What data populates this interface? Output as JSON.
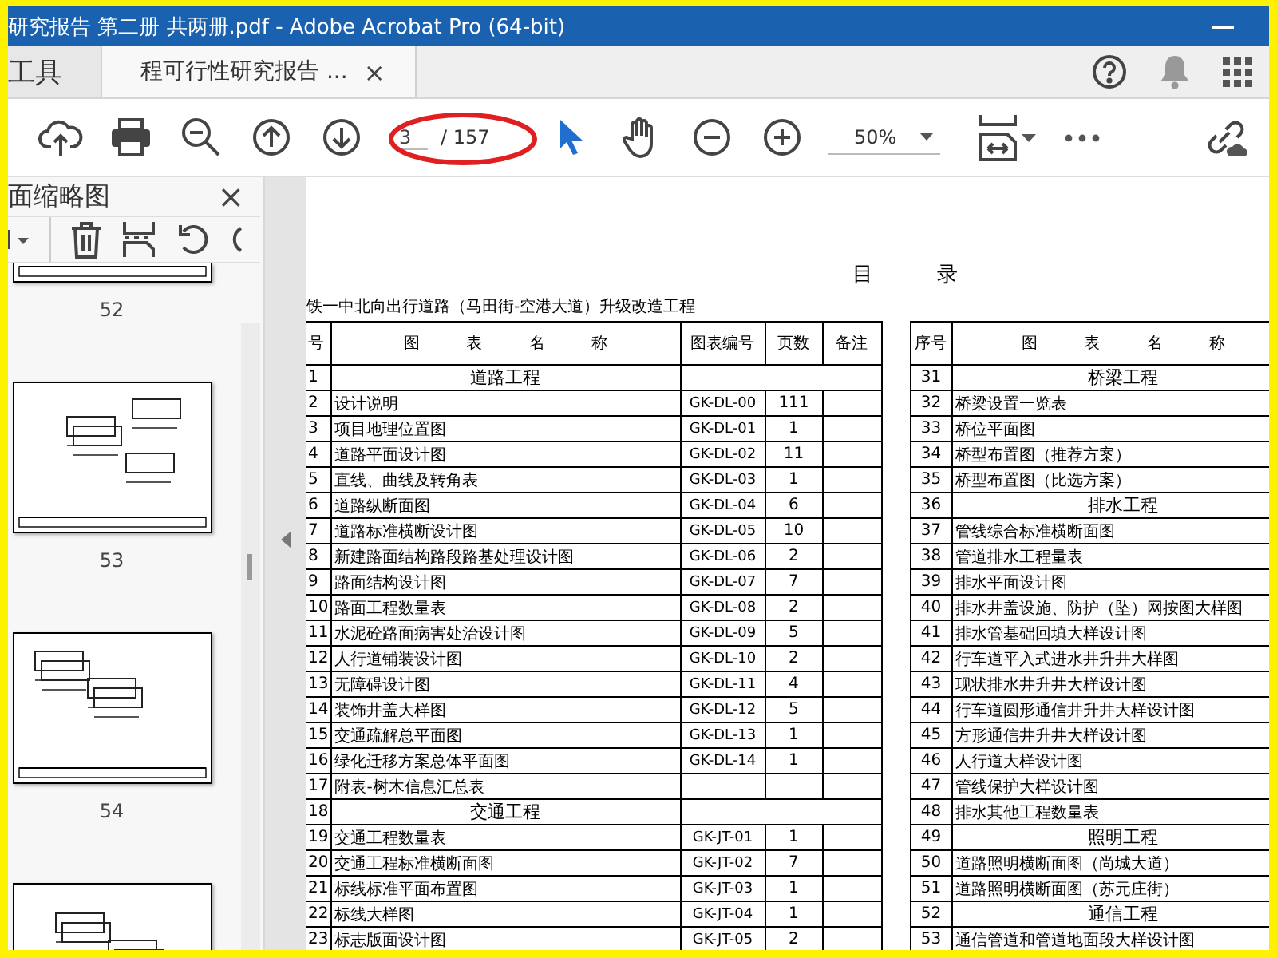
{
  "window": {
    "title": "研究报告 第二册 共两册.pdf - Adobe Acrobat Pro (64-bit)"
  },
  "tabs": [
    {
      "label": "工具",
      "kind": "home",
      "selected": false
    },
    {
      "label": "程可行性研究报告 ...",
      "kind": "document",
      "selected": true,
      "close": "×"
    }
  ],
  "toolbar": {
    "page_field": "3",
    "page_total": "/ 157",
    "zoom": "50%"
  },
  "sidebar": {
    "title": "面缩略图",
    "close": "×",
    "thumbnails": [
      {
        "label": "52",
        "kind": "cut_top"
      },
      {
        "label": "53",
        "kind": "full"
      },
      {
        "label": "54",
        "kind": "full"
      },
      {
        "kind": "cut_bottom"
      }
    ]
  },
  "document": {
    "heading": "目 录",
    "subtitle": "铁一中北向出行道路（马田街-空港大道）升级改造工程",
    "left_table": {
      "columns": [
        "号",
        "图 表 名 称",
        "图表编号",
        "页数",
        "备注"
      ],
      "rows": [
        {
          "kind": "section",
          "no": "1",
          "name": "道路工程"
        },
        {
          "kind": "item",
          "no": "2",
          "name": "设计说明",
          "code": "GK-DL-00",
          "pages": "111"
        },
        {
          "kind": "item",
          "no": "3",
          "name": "项目地理位置图",
          "code": "GK-DL-01",
          "pages": "1"
        },
        {
          "kind": "item",
          "no": "4",
          "name": "道路平面设计图",
          "code": "GK-DL-02",
          "pages": "11"
        },
        {
          "kind": "item",
          "no": "5",
          "name": "直线、曲线及转角表",
          "code": "GK-DL-03",
          "pages": "1"
        },
        {
          "kind": "item",
          "no": "6",
          "name": "道路纵断面图",
          "code": "GK-DL-04",
          "pages": "6"
        },
        {
          "kind": "item",
          "no": "7",
          "name": "道路标准横断设计图",
          "code": "GK-DL-05",
          "pages": "10"
        },
        {
          "kind": "item",
          "no": "8",
          "name": "新建路面结构路段路基处理设计图",
          "code": "GK-DL-06",
          "pages": "2"
        },
        {
          "kind": "item",
          "no": "9",
          "name": "路面结构设计图",
          "code": "GK-DL-07",
          "pages": "7"
        },
        {
          "kind": "item",
          "no": "10",
          "name": "路面工程数量表",
          "code": "GK-DL-08",
          "pages": "2"
        },
        {
          "kind": "item",
          "no": "11",
          "name": "水泥砼路面病害处治设计图",
          "code": "GK-DL-09",
          "pages": "5"
        },
        {
          "kind": "item",
          "no": "12",
          "name": "人行道铺装设计图",
          "code": "GK-DL-10",
          "pages": "2"
        },
        {
          "kind": "item",
          "no": "13",
          "name": "无障碍设计图",
          "code": "GK-DL-11",
          "pages": "4"
        },
        {
          "kind": "item",
          "no": "14",
          "name": "装饰井盖大样图",
          "code": "GK-DL-12",
          "pages": "5"
        },
        {
          "kind": "item",
          "no": "15",
          "name": "交通疏解总平面图",
          "code": "GK-DL-13",
          "pages": "1"
        },
        {
          "kind": "item",
          "no": "16",
          "name": "绿化迁移方案总体平面图",
          "code": "GK-DL-14",
          "pages": "1"
        },
        {
          "kind": "item",
          "no": "17",
          "name": "附表-树木信息汇总表"
        },
        {
          "kind": "section",
          "no": "18",
          "name": "交通工程"
        },
        {
          "kind": "item",
          "no": "19",
          "name": "交通工程数量表",
          "code": "GK-JT-01",
          "pages": "1"
        },
        {
          "kind": "item",
          "no": "20",
          "name": "交通工程标准横断面图",
          "code": "GK-JT-02",
          "pages": "7"
        },
        {
          "kind": "item",
          "no": "21",
          "name": "标线标准平面布置图",
          "code": "GK-JT-03",
          "pages": "1"
        },
        {
          "kind": "item",
          "no": "22",
          "name": "标线大样图",
          "code": "GK-JT-04",
          "pages": "1"
        },
        {
          "kind": "item",
          "no": "23",
          "name": "标志版面设计图",
          "code": "GK-JT-05",
          "pages": "2"
        }
      ]
    },
    "right_table": {
      "columns": [
        "序号",
        "图 表 名 称"
      ],
      "rows": [
        {
          "kind": "section",
          "no": "31",
          "name": "桥梁工程"
        },
        {
          "kind": "item",
          "no": "32",
          "name": "桥梁设置一览表"
        },
        {
          "kind": "item",
          "no": "33",
          "name": "桥位平面图"
        },
        {
          "kind": "item",
          "no": "34",
          "name": "桥型布置图（推荐方案）"
        },
        {
          "kind": "item",
          "no": "35",
          "name": "桥型布置图（比选方案）"
        },
        {
          "kind": "section",
          "no": "36",
          "name": "排水工程"
        },
        {
          "kind": "item",
          "no": "37",
          "name": "管线综合标准横断面图"
        },
        {
          "kind": "item",
          "no": "38",
          "name": "管道排水工程量表"
        },
        {
          "kind": "item",
          "no": "39",
          "name": "排水平面设计图"
        },
        {
          "kind": "item",
          "no": "40",
          "name": "排水井盖设施、防护（坠）网按图大样图"
        },
        {
          "kind": "item",
          "no": "41",
          "name": "排水管基础回填大样设计图"
        },
        {
          "kind": "item",
          "no": "42",
          "name": "行车道平入式进水井升井大样图"
        },
        {
          "kind": "item",
          "no": "43",
          "name": "现状排水井升井大样设计图"
        },
        {
          "kind": "item",
          "no": "44",
          "name": "行车道圆形通信井升井大样设计图"
        },
        {
          "kind": "item",
          "no": "45",
          "name": "方形通信井升井大样设计图"
        },
        {
          "kind": "item",
          "no": "46",
          "name": "人行道大样设计图"
        },
        {
          "kind": "item",
          "no": "47",
          "name": "管线保护大样设计图"
        },
        {
          "kind": "item",
          "no": "48",
          "name": "排水其他工程数量表"
        },
        {
          "kind": "section",
          "no": "49",
          "name": "照明工程"
        },
        {
          "kind": "item",
          "no": "50",
          "name": "道路照明横断面图（尚城大道）"
        },
        {
          "kind": "item",
          "no": "51",
          "name": "道路照明横断面图（苏元庄街）"
        },
        {
          "kind": "section",
          "no": "52",
          "name": "通信工程"
        },
        {
          "kind": "item",
          "no": "53",
          "name": "通信管道和管道地面段大样设计图"
        }
      ]
    }
  }
}
